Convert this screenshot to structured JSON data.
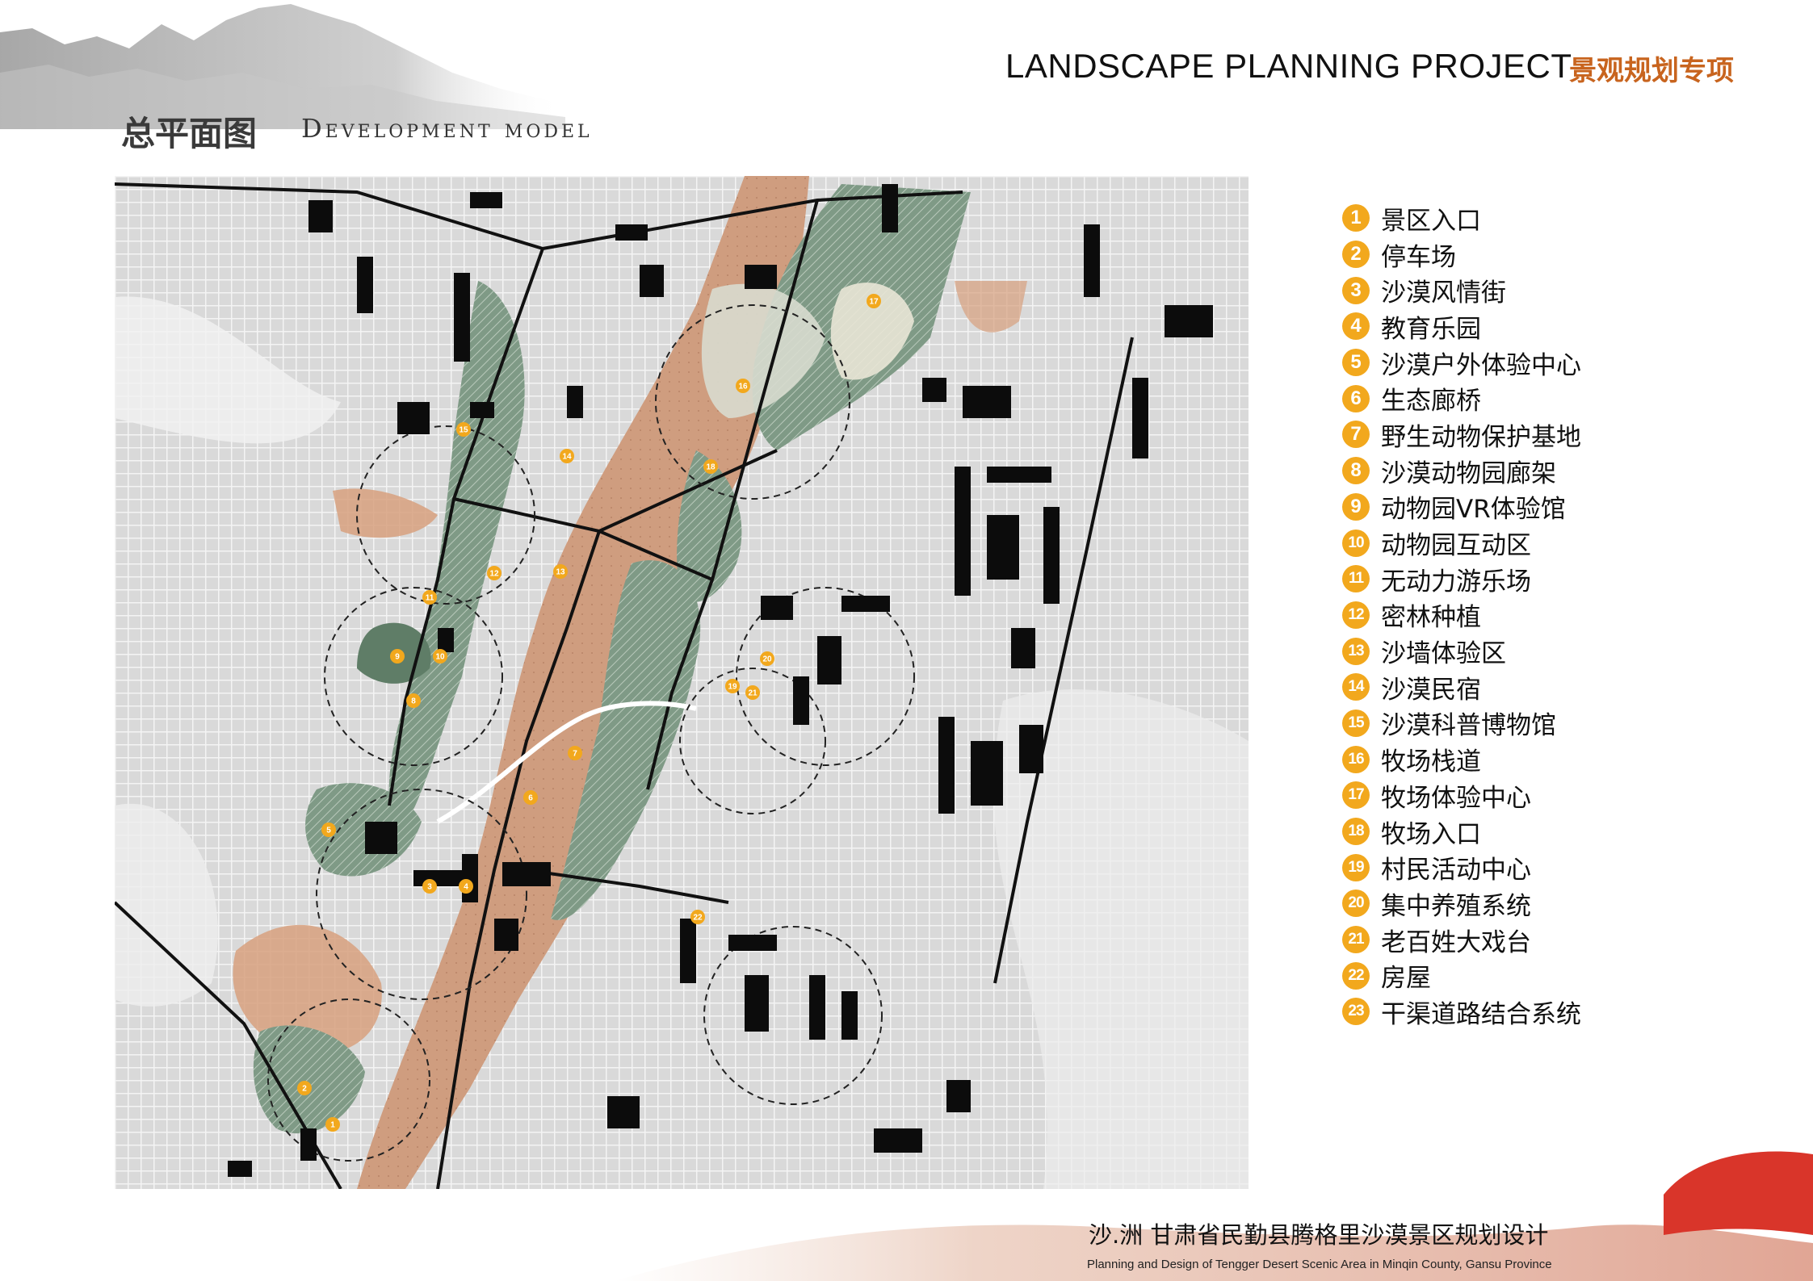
{
  "header": {
    "title_en": "LANDSCAPE PLANNING PROJECT",
    "title_cn": "景观规划专项"
  },
  "page": {
    "title_cn": "总平面图",
    "title_en": "Development model"
  },
  "legend": [
    {
      "num": "1",
      "label": "景区入口"
    },
    {
      "num": "2",
      "label": "停车场"
    },
    {
      "num": "3",
      "label": "沙漠风情街"
    },
    {
      "num": "4",
      "label": "教育乐园"
    },
    {
      "num": "5",
      "label": "沙漠户外体验中心"
    },
    {
      "num": "6",
      "label": "生态廊桥"
    },
    {
      "num": "7",
      "label": "野生动物保护基地"
    },
    {
      "num": "8",
      "label": "沙漠动物园廊架"
    },
    {
      "num": "9",
      "label": "动物园VR体验馆"
    },
    {
      "num": "10",
      "label": "动物园互动区"
    },
    {
      "num": "11",
      "label": "无动力游乐场"
    },
    {
      "num": "12",
      "label": "密林种植"
    },
    {
      "num": "13",
      "label": "沙墙体验区"
    },
    {
      "num": "14",
      "label": "沙漠民宿"
    },
    {
      "num": "15",
      "label": "沙漠科普博物馆"
    },
    {
      "num": "16",
      "label": "牧场栈道"
    },
    {
      "num": "17",
      "label": "牧场体验中心"
    },
    {
      "num": "18",
      "label": "牧场入口"
    },
    {
      "num": "19",
      "label": "村民活动中心"
    },
    {
      "num": "20",
      "label": "集中养殖系统"
    },
    {
      "num": "21",
      "label": "老百姓大戏台"
    },
    {
      "num": "22",
      "label": "房屋"
    },
    {
      "num": "23",
      "label": "干渠道路结合系统"
    }
  ],
  "map_markers": [
    "1",
    "2",
    "3",
    "4",
    "5",
    "6",
    "7",
    "8",
    "9",
    "10",
    "11",
    "12",
    "13",
    "14",
    "15",
    "16",
    "17",
    "18",
    "19",
    "20",
    "21",
    "22"
  ],
  "footer": {
    "title_cn": "沙.洲  甘肃省民勤县腾格里沙漠景区规划设计",
    "title_en": "Planning and Design of Tengger Desert Scenic Area in Minqin County, Gansu Province"
  },
  "colors": {
    "accent_orange": "#f2a81d",
    "header_cn": "#c8641e",
    "sand": "#d7a07e",
    "green": "#7f9a86",
    "footer_red": "#d9352a"
  }
}
